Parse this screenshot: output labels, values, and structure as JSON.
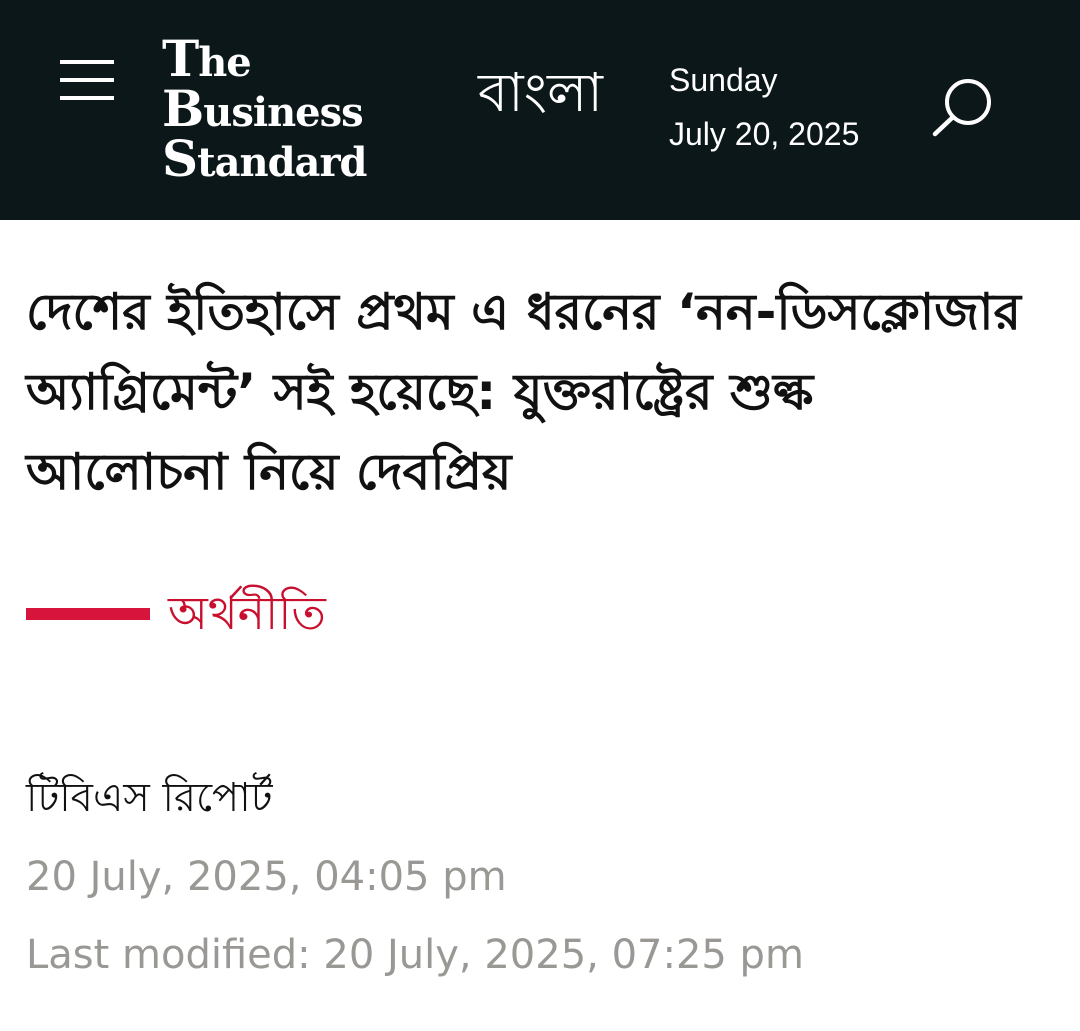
{
  "header": {
    "menu_icon": "hamburger-menu-icon",
    "logo_lines": [
      "The",
      "Business",
      "Standard"
    ],
    "language_link": "বাংলা",
    "day": "Sunday",
    "date": "July 20, 2025",
    "search_icon": "search-icon",
    "background_color": "#0c1719"
  },
  "article": {
    "headline": "দেশের ইতিহাসে প্রথম এ ধরনের ‘নন-ডিসক্লোজার অ্যাগ্রিমেন্ট’ সই হয়েছে: যুক্তরাষ্ট্রের শুল্ক আলোচনা নিয়ে দেবপ্রিয়",
    "category": "অর্থনীতি",
    "category_color": "#c8102e",
    "author": "টিবিএস রিপোর্ট",
    "published": "20 July, 2025, 04:05 pm",
    "modified": "Last modified: 20 July, 2025, 07:25 pm"
  }
}
